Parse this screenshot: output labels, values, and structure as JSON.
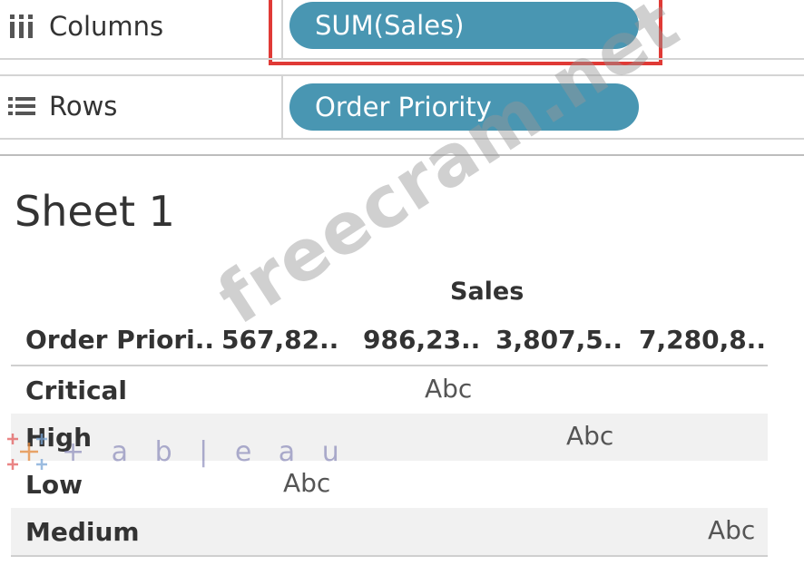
{
  "shelves": {
    "columns": {
      "label": "Columns",
      "icon": "columns-icon",
      "pill": "SUM(Sales)"
    },
    "rows": {
      "label": "Rows",
      "icon": "rows-icon",
      "pill": "Order Priority"
    }
  },
  "sheet": {
    "title": "Sheet 1",
    "measure_title": "Sales",
    "axis": {
      "dimension_header": "Order Priori..",
      "ticks": [
        "567,82..",
        "986,23..",
        "3,807,5..",
        "7,280,8.."
      ]
    },
    "rows": [
      {
        "label": "Critical",
        "mark": "Abc"
      },
      {
        "label": "High",
        "mark": "Abc"
      },
      {
        "label": "Low",
        "mark": "Abc"
      },
      {
        "label": "Medium",
        "mark": "Abc"
      }
    ]
  },
  "colors": {
    "pill": "#4996b2",
    "highlight": "#e03a36",
    "shaded_row": "#f1f1f1"
  },
  "watermark": {
    "site": "freecram.net",
    "brand": "tableau"
  }
}
